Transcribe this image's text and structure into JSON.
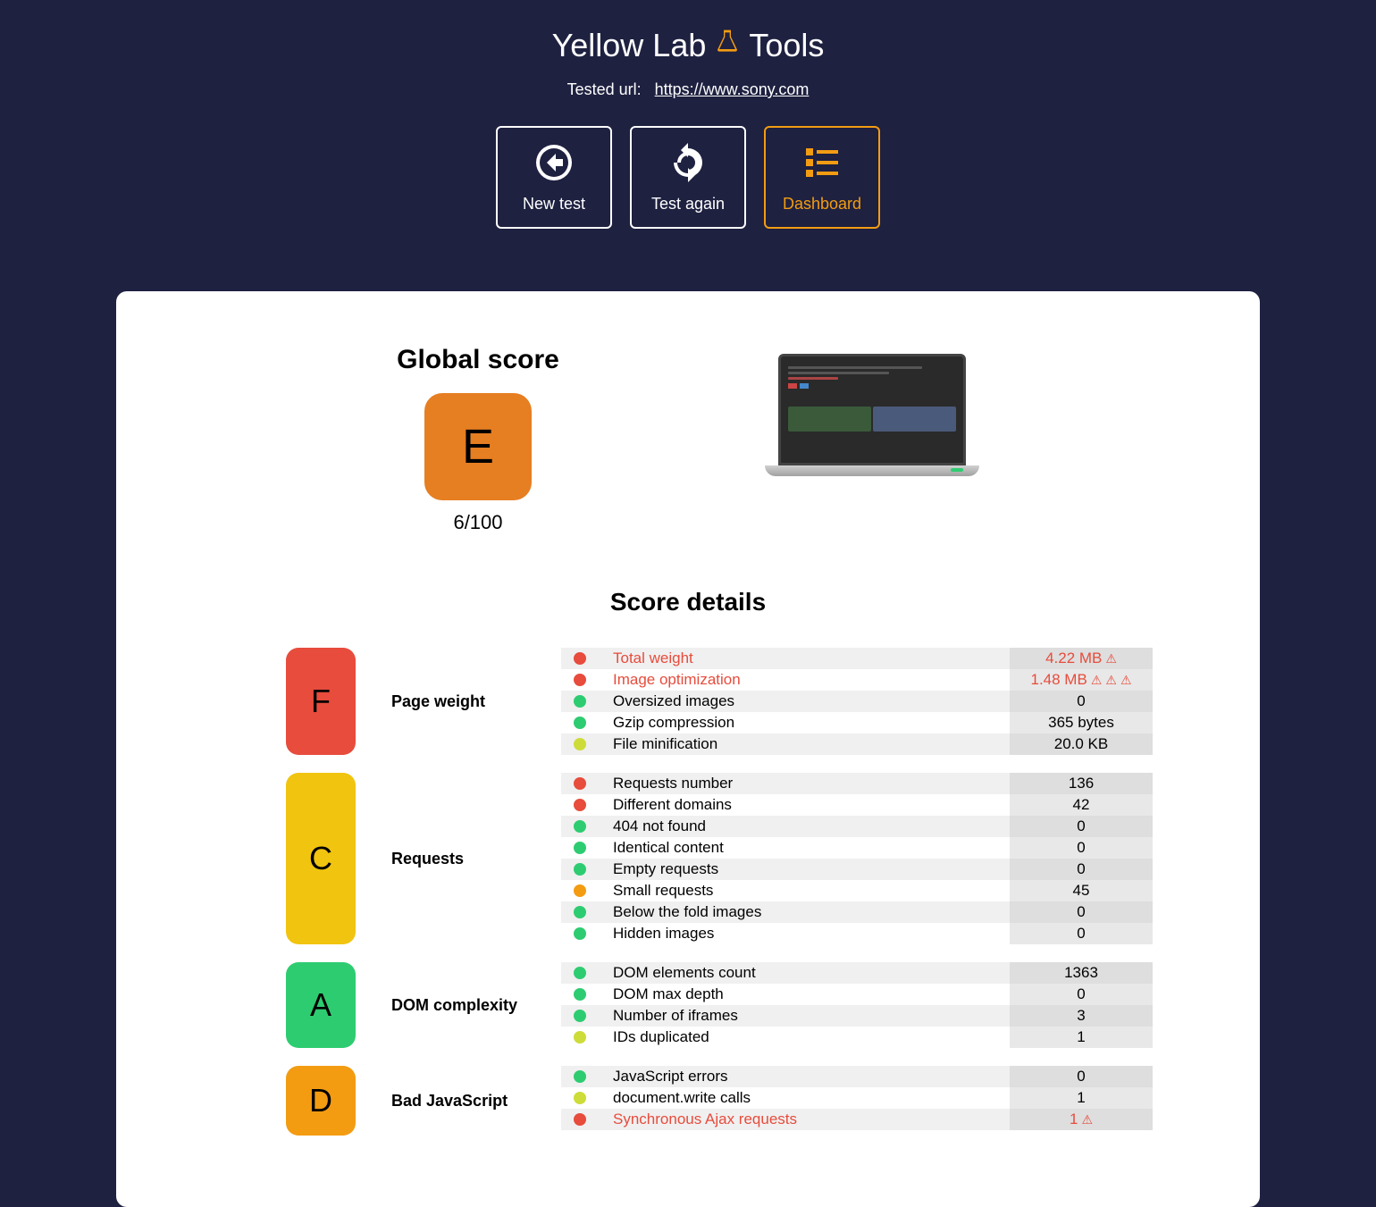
{
  "header": {
    "title_prefix": "Yellow Lab",
    "title_suffix": "Tools",
    "tested_label": "Tested url:",
    "tested_url": "https://www.sony.com"
  },
  "nav": {
    "new_test": "New test",
    "test_again": "Test again",
    "dashboard": "Dashboard"
  },
  "global": {
    "title": "Global score",
    "grade": "E",
    "score": "6/100"
  },
  "details_title": "Score details",
  "categories": [
    {
      "grade": "F",
      "title": "Page weight",
      "metrics": [
        {
          "dot": "red",
          "name": "Total weight",
          "value": "4.22 MB",
          "warn": true,
          "warn_count": 1
        },
        {
          "dot": "red",
          "name": "Image optimization",
          "value": "1.48 MB",
          "warn": true,
          "warn_count": 3
        },
        {
          "dot": "green",
          "name": "Oversized images",
          "value": "0"
        },
        {
          "dot": "green",
          "name": "Gzip compression",
          "value": "365 bytes"
        },
        {
          "dot": "yellow",
          "name": "File minification",
          "value": "20.0 KB"
        }
      ]
    },
    {
      "grade": "C",
      "title": "Requests",
      "metrics": [
        {
          "dot": "red",
          "name": "Requests number",
          "value": "136"
        },
        {
          "dot": "red",
          "name": "Different domains",
          "value": "42"
        },
        {
          "dot": "green",
          "name": "404 not found",
          "value": "0"
        },
        {
          "dot": "green",
          "name": "Identical content",
          "value": "0"
        },
        {
          "dot": "green",
          "name": "Empty requests",
          "value": "0"
        },
        {
          "dot": "orange",
          "name": "Small requests",
          "value": "45"
        },
        {
          "dot": "green",
          "name": "Below the fold images",
          "value": "0"
        },
        {
          "dot": "green",
          "name": "Hidden images",
          "value": "0"
        }
      ]
    },
    {
      "grade": "A",
      "title": "DOM complexity",
      "metrics": [
        {
          "dot": "green",
          "name": "DOM elements count",
          "value": "1363"
        },
        {
          "dot": "green",
          "name": "DOM max depth",
          "value": "0"
        },
        {
          "dot": "green",
          "name": "Number of iframes",
          "value": "3"
        },
        {
          "dot": "yellow",
          "name": "IDs duplicated",
          "value": "1"
        }
      ]
    },
    {
      "grade": "D",
      "title": "Bad JavaScript",
      "metrics": [
        {
          "dot": "green",
          "name": "JavaScript errors",
          "value": "0"
        },
        {
          "dot": "yellow",
          "name": "document.write calls",
          "value": "1"
        },
        {
          "dot": "red",
          "name": "Synchronous Ajax requests",
          "value": "1",
          "warn": true,
          "warn_count": 1
        }
      ]
    }
  ]
}
